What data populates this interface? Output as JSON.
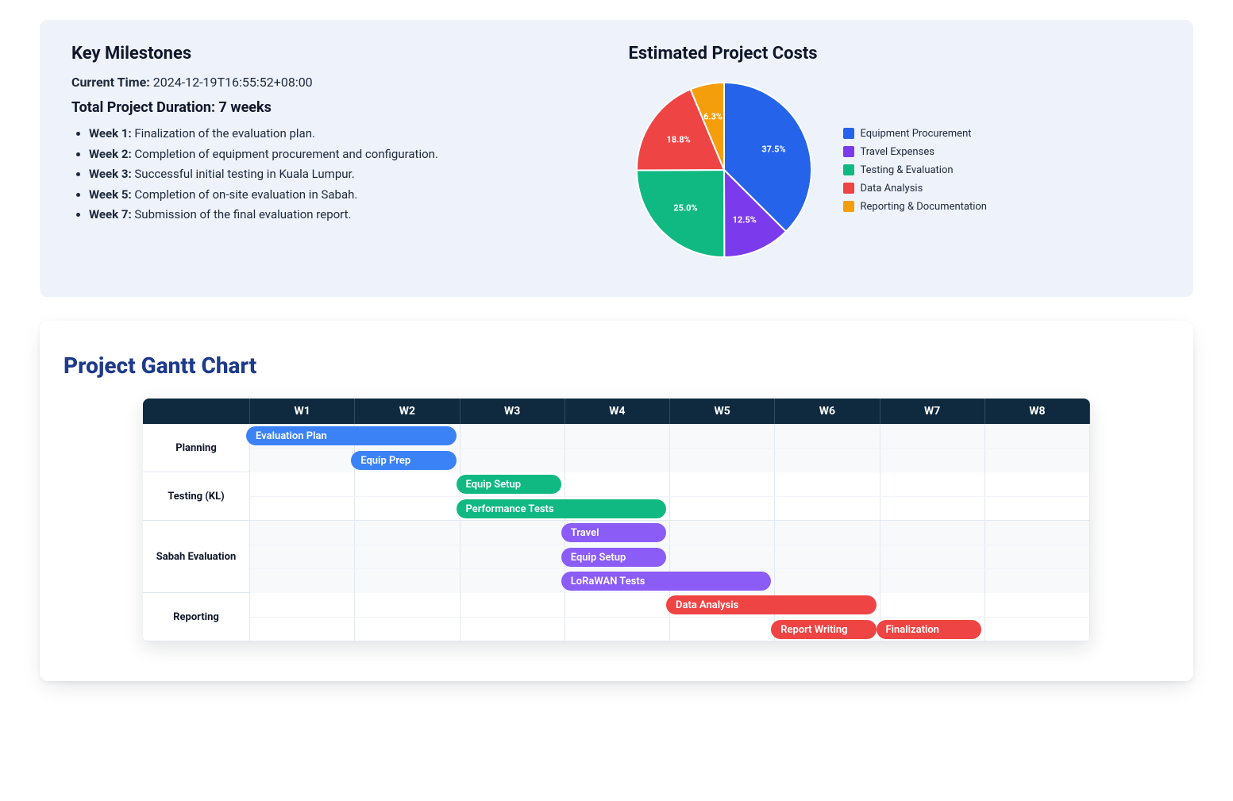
{
  "milestones_panel": {
    "title": "Key Milestones",
    "current_time_label": "Current Time:",
    "current_time_value": "2024-12-19T16:55:52+08:00",
    "duration_label": "Total Project Duration: 7 weeks",
    "items": [
      {
        "week": "Week 1:",
        "text": "Finalization of the evaluation plan."
      },
      {
        "week": "Week 2:",
        "text": "Completion of equipment procurement and configuration."
      },
      {
        "week": "Week 3:",
        "text": "Successful initial testing in Kuala Lumpur."
      },
      {
        "week": "Week 5:",
        "text": "Completion of on-site evaluation in Sabah."
      },
      {
        "week": "Week 7:",
        "text": "Submission of the final evaluation report."
      }
    ]
  },
  "costs_panel": {
    "title": "Estimated Project Costs"
  },
  "chart_data": {
    "pie": {
      "type": "pie",
      "title": "Estimated Project Costs",
      "series": [
        {
          "name": "Equipment Procurement",
          "value": 37.5,
          "label": "37.5%",
          "color": "#2563eb"
        },
        {
          "name": "Travel Expenses",
          "value": 12.5,
          "label": "12.5%",
          "color": "#7c3aed"
        },
        {
          "name": "Testing & Evaluation",
          "value": 25.0,
          "label": "25.0%",
          "color": "#10b981"
        },
        {
          "name": "Data Analysis",
          "value": 18.8,
          "label": "18.8%",
          "color": "#ef4444"
        },
        {
          "name": "Reporting & Documentation",
          "value": 6.3,
          "label": "6.3%",
          "color": "#f59e0b"
        }
      ]
    },
    "gantt": {
      "type": "gantt",
      "title": "Project Gantt Chart",
      "weeks": [
        "W1",
        "W2",
        "W3",
        "W4",
        "W5",
        "W6",
        "W7",
        "W8"
      ],
      "phases": [
        {
          "name": "Planning",
          "color": "#3b82f6",
          "tasks": [
            {
              "name": "Evaluation Plan",
              "start": 0.0,
              "end": 2.0
            },
            {
              "name": "Equip Prep",
              "start": 1.0,
              "end": 2.0
            }
          ]
        },
        {
          "name": "Testing (KL)",
          "color": "#10b981",
          "tasks": [
            {
              "name": "Equip Setup",
              "start": 2.0,
              "end": 3.0
            },
            {
              "name": "Performance Tests",
              "start": 2.0,
              "end": 4.0
            }
          ]
        },
        {
          "name": "Sabah Evaluation",
          "color": "#8b5cf6",
          "tasks": [
            {
              "name": "Travel",
              "start": 3.0,
              "end": 4.0
            },
            {
              "name": "Equip Setup",
              "start": 3.0,
              "end": 4.0
            },
            {
              "name": "LoRaWAN Tests",
              "start": 3.0,
              "end": 5.0
            }
          ]
        },
        {
          "name": "Reporting",
          "color": "#ef4444",
          "tasks": [
            {
              "name": "Data Analysis",
              "start": 4.0,
              "end": 6.0
            },
            {
              "name": "Report Writing",
              "start": 5.0,
              "end": 6.0
            },
            {
              "name": "Finalization",
              "start": 6.0,
              "end": 7.0
            }
          ]
        }
      ]
    }
  }
}
